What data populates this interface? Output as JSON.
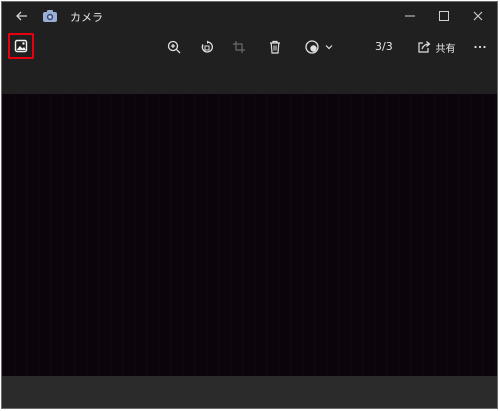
{
  "window": {
    "title": "カメラ",
    "controls": [
      "minimize-icon",
      "maximize-icon",
      "close-icon"
    ]
  },
  "toolbar": {
    "tools": [
      "gallery-icon",
      "zoom-in-icon",
      "rotate-icon",
      "crop-icon",
      "delete-icon",
      "filter-icon"
    ],
    "counter": "3/3",
    "share_label": "共有",
    "more_icon": "more-icon"
  },
  "colors": {
    "window_bg": "#202020",
    "viewer_bg": "#0b040b",
    "highlight": "#e60012",
    "text": "#e6e6e6"
  }
}
